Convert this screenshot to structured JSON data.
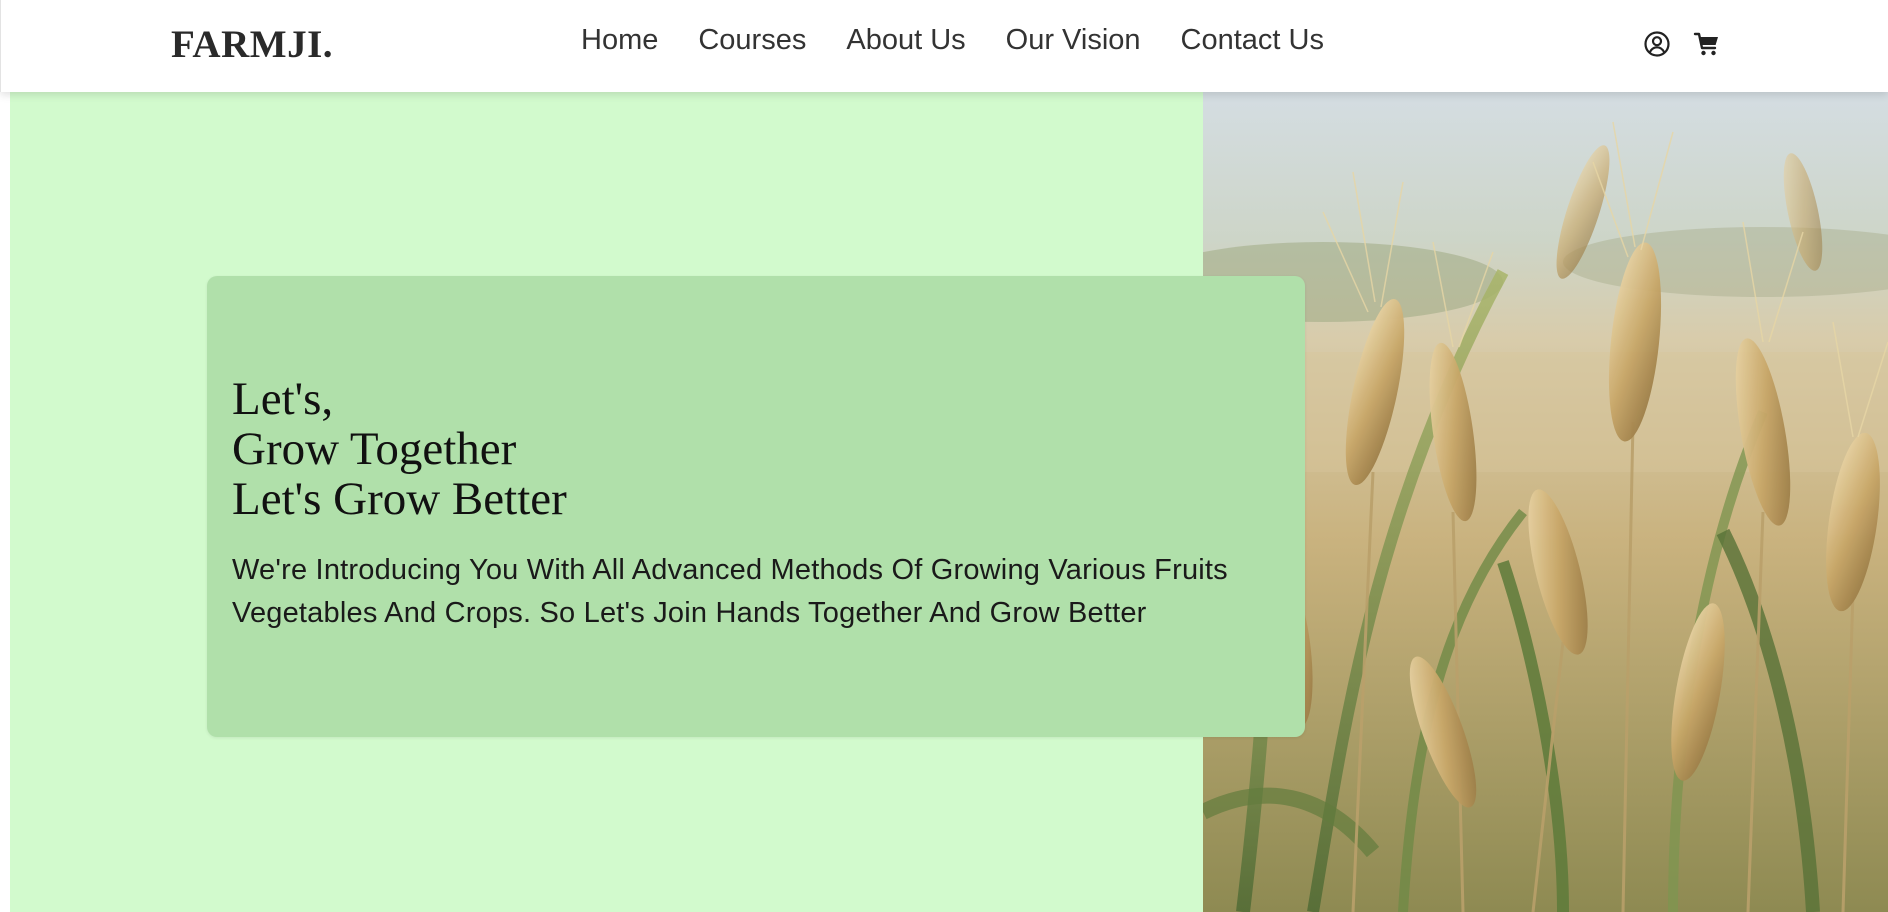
{
  "navbar": {
    "brand": "FARMJI.",
    "links": [
      {
        "label": "Home"
      },
      {
        "label": "Courses"
      },
      {
        "label": "About Us"
      },
      {
        "label": "Our Vision"
      },
      {
        "label": "Contact Us"
      }
    ],
    "icons": [
      "user-circle-icon",
      "cart-icon"
    ]
  },
  "hero": {
    "title_lines": [
      "Let's,",
      "Grow Together",
      "Let's Grow Better"
    ],
    "description": "We're Introducing You With All Advanced Methods Of Growing Various Fruits Vegetables And Crops. So Let's Join Hands Together And Grow Better",
    "image": "wheat-field-photo",
    "colors": {
      "background": "#d2facd",
      "card": "#b0e0aa"
    }
  }
}
